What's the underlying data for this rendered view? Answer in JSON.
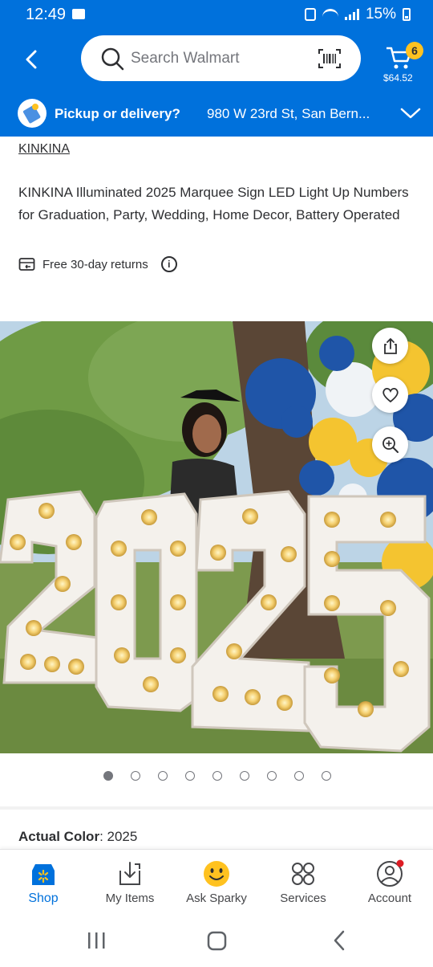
{
  "status_bar": {
    "time": "12:49",
    "battery": "15%"
  },
  "header": {
    "search_placeholder": "Search Walmart",
    "cart_count": "6",
    "cart_total": "$64.52",
    "pickup_label": "Pickup or delivery?",
    "pickup_address": "980 W 23rd St, San Bern..."
  },
  "product": {
    "brand": "KINKINA",
    "title": "KINKINA Illuminated 2025 Marquee Sign LED Light Up Numbers for Graduation, Party, Wedding, Home Decor, Battery Operated",
    "returns": "Free 30-day returns",
    "image_digits": "2025",
    "carousel_total": 9,
    "carousel_active_index": 0,
    "color_label": "Actual Color",
    "color_value": "2025"
  },
  "bottom_nav": [
    {
      "label": "Shop",
      "icon": "spark-store-icon",
      "active": true
    },
    {
      "label": "My Items",
      "icon": "my-items-icon",
      "active": false
    },
    {
      "label": "Ask Sparky",
      "icon": "sparky-face-icon",
      "active": false
    },
    {
      "label": "Services",
      "icon": "services-grid-icon",
      "active": false
    },
    {
      "label": "Account",
      "icon": "account-icon",
      "active": false
    }
  ],
  "colors": {
    "brand_blue": "#0071dc",
    "spark_yellow": "#ffc220",
    "text": "#2e2f32"
  }
}
